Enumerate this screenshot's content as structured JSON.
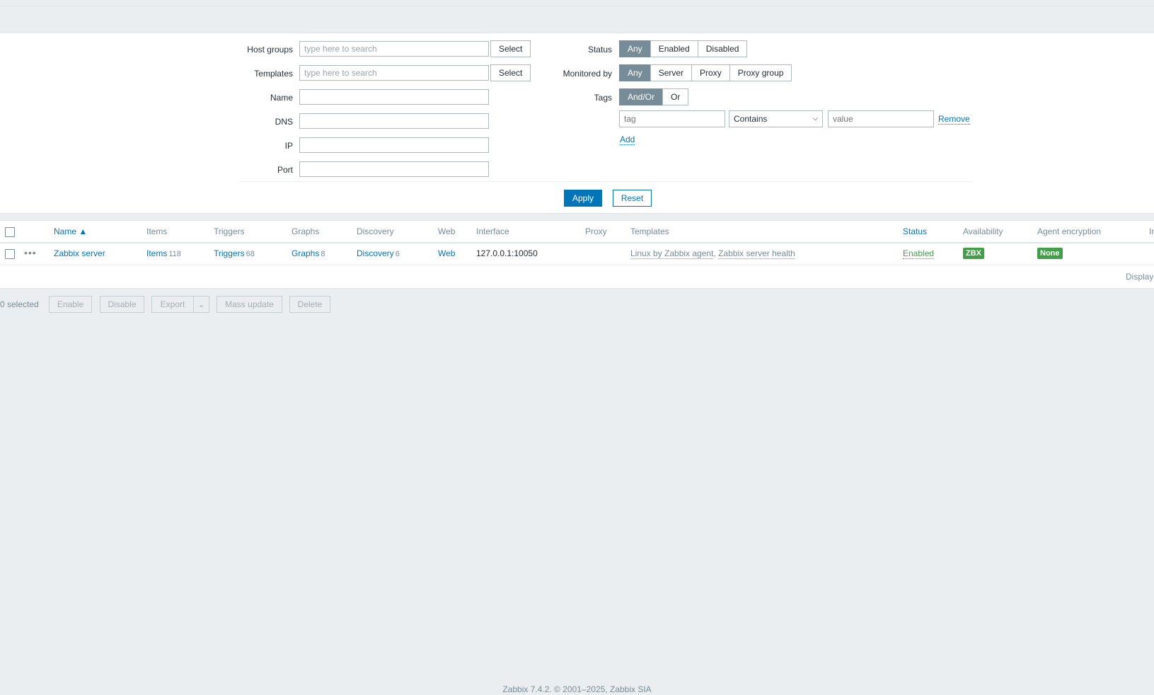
{
  "filter": {
    "host_groups": {
      "label": "Host groups",
      "placeholder": "type here to search",
      "button": "Select"
    },
    "templates": {
      "label": "Templates",
      "placeholder": "type here to search",
      "button": "Select"
    },
    "name": {
      "label": "Name",
      "value": ""
    },
    "dns": {
      "label": "DNS",
      "value": ""
    },
    "ip": {
      "label": "IP",
      "value": ""
    },
    "port": {
      "label": "Port",
      "value": ""
    },
    "status": {
      "label": "Status",
      "options": [
        "Any",
        "Enabled",
        "Disabled"
      ],
      "selected": "Any"
    },
    "monitored_by": {
      "label": "Monitored by",
      "options": [
        "Any",
        "Server",
        "Proxy",
        "Proxy group"
      ],
      "selected": "Any"
    },
    "tags": {
      "label": "Tags",
      "options": [
        "And/Or",
        "Or"
      ],
      "selected": "And/Or",
      "tag_placeholder": "tag",
      "operator": "Contains",
      "value_placeholder": "value",
      "remove": "Remove",
      "add": "Add"
    },
    "apply": "Apply",
    "reset": "Reset"
  },
  "table": {
    "columns": {
      "name": "Name ▲",
      "items": "Items",
      "triggers": "Triggers",
      "graphs": "Graphs",
      "discovery": "Discovery",
      "web": "Web",
      "interface": "Interface",
      "proxy": "Proxy",
      "templates": "Templates",
      "status": "Status",
      "availability": "Availability",
      "agent_encryption": "Agent encryption",
      "info": "In"
    },
    "rows": [
      {
        "name": "Zabbix server",
        "items_label": "Items",
        "items_count": "118",
        "triggers_label": "Triggers",
        "triggers_count": "68",
        "graphs_label": "Graphs",
        "graphs_count": "8",
        "discovery_label": "Discovery",
        "discovery_count": "6",
        "web": "Web",
        "interface": "127.0.0.1:10050",
        "proxy": "",
        "template_1": "Linux by Zabbix agent",
        "template_sep": ", ",
        "template_2": "Zabbix server health",
        "status": "Enabled",
        "availability": "ZBX",
        "encryption": "None"
      }
    ],
    "display": "Display"
  },
  "actions": {
    "selected": "0 selected",
    "enable": "Enable",
    "disable": "Disable",
    "export": "Export",
    "mass_update": "Mass update",
    "delete": "Delete"
  },
  "footer": "Zabbix 7.4.2. © 2001–2025, Zabbix SIA",
  "colors": {
    "accent": "#0275b8",
    "enabled": "#429e47",
    "segment_on": "#768d99"
  }
}
